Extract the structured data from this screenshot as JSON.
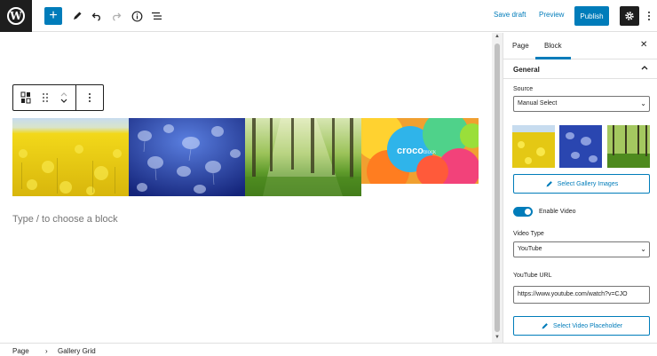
{
  "topbar": {
    "wp_logo": "W",
    "add_icon": "+",
    "save_draft": "Save draft",
    "preview": "Preview",
    "publish": "Publish"
  },
  "canvas": {
    "gallery_tiles": [
      {
        "name": "rapeseed-field-image",
        "colors": [
          "#a8c6e8",
          "#f4d616",
          "#c9a80c"
        ]
      },
      {
        "name": "jellyfish-image",
        "colors": [
          "#1d3a9c",
          "#5577d8",
          "#1a2a80"
        ]
      },
      {
        "name": "forest-sunlight-image",
        "colors": [
          "#e8f0c8",
          "#5a8a2a",
          "#2d4a18"
        ]
      },
      {
        "name": "crocoblock-bubbles-image",
        "colors": [
          "#ff8a1f",
          "#2ab0e8",
          "#f04a7a"
        ]
      }
    ],
    "croco_logo_text": "croco",
    "croco_logo_suffix": "block",
    "placeholder": "Type / to choose a block"
  },
  "sidebar": {
    "tabs": [
      {
        "label": "Page",
        "active": false
      },
      {
        "label": "Block",
        "active": true
      }
    ],
    "close_icon": "✕",
    "section_general": "General",
    "source_label": "Source",
    "source_value": "Manual Select",
    "select_gallery_button": "Select Gallery Images",
    "enable_video_label": "Enable Video",
    "enable_video_on": true,
    "video_type_label": "Video Type",
    "video_type_value": "YouTube",
    "youtube_url_label": "YouTube URL",
    "youtube_url_value": "https://www.youtube.com/watch?v=CJO",
    "select_placeholder_button": "Select Video Placeholder"
  },
  "breadcrumb": {
    "items": [
      "Page",
      "Gallery Grid"
    ],
    "separator": "›"
  },
  "colors": {
    "accent": "#007cba",
    "dark": "#1e1e1e"
  }
}
